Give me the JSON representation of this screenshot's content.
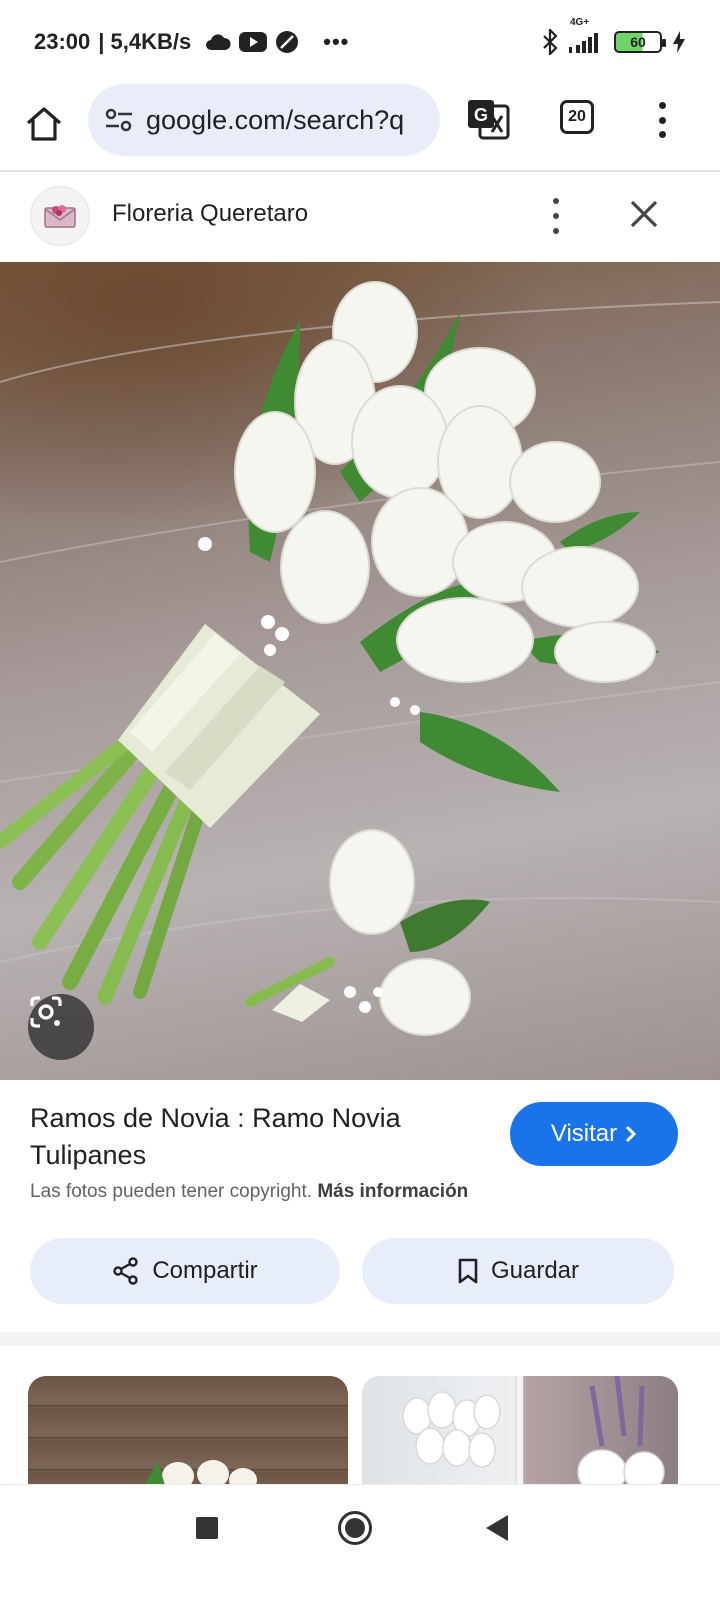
{
  "status_bar": {
    "time": "23:00",
    "network_speed": "| 5,4KB/s",
    "overflow": "•••",
    "network_type": "4G+",
    "battery_level": "60",
    "icons": [
      "cloud-icon",
      "youtube-icon",
      "vpn-icon",
      "bluetooth-icon",
      "signal-icon",
      "charging-icon"
    ]
  },
  "browser": {
    "url": "google.com/search?q",
    "tab_count": "20",
    "icons": [
      "home-icon",
      "site-settings-icon",
      "translate-icon",
      "menu-icon"
    ]
  },
  "source": {
    "name": "Floreria Queretaro"
  },
  "result": {
    "title": "Ramos de Novia : Ramo Novia Tulipanes",
    "visit_label": "Visitar",
    "copyright_text": "Las fotos pueden tener copyright.",
    "more_info_label": "Más información",
    "share_label": "Compartir",
    "save_label": "Guardar"
  },
  "colors": {
    "accent": "#1a73e8",
    "pill_background": "#e8eef9",
    "url_background": "#e8edf7"
  }
}
